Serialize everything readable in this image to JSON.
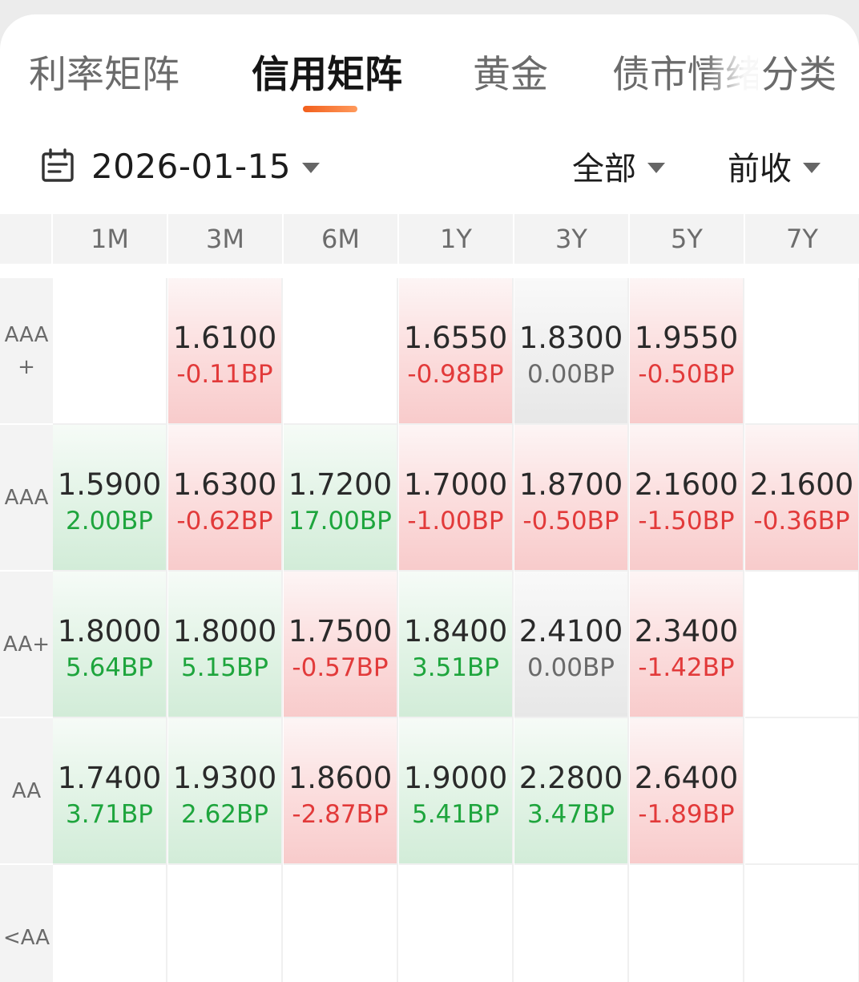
{
  "tabs": [
    {
      "label": "利率矩阵",
      "active": false
    },
    {
      "label": "信用矩阵",
      "active": true
    },
    {
      "label": "黄金",
      "active": false
    },
    {
      "label": "债市情绪",
      "active": false
    },
    {
      "label": "分类",
      "active": false
    }
  ],
  "filters": {
    "date": "2026-01-15",
    "scope": "全部",
    "basis": "前收"
  },
  "colors": {
    "accent": "#f25f1c",
    "up_text": "#e23a3a",
    "down_text": "#1ea53d",
    "flat_text": "#6a6a6a"
  },
  "matrix": {
    "columns": [
      "1M",
      "3M",
      "6M",
      "1Y",
      "3Y",
      "5Y",
      "7Y"
    ],
    "rows": [
      {
        "label": "AAA+",
        "cells": [
          null,
          {
            "rate": "1.6100",
            "change": "-0.11BP",
            "dir": "up"
          },
          null,
          {
            "rate": "1.6550",
            "change": "-0.98BP",
            "dir": "up"
          },
          {
            "rate": "1.8300",
            "change": "0.00BP",
            "dir": "flat"
          },
          {
            "rate": "1.9550",
            "change": "-0.50BP",
            "dir": "up"
          },
          null
        ]
      },
      {
        "label": "AAA",
        "cells": [
          {
            "rate": "1.5900",
            "change": "2.00BP",
            "dir": "down"
          },
          {
            "rate": "1.6300",
            "change": "-0.62BP",
            "dir": "up"
          },
          {
            "rate": "1.7200",
            "change": "17.00BP",
            "dir": "down"
          },
          {
            "rate": "1.7000",
            "change": "-1.00BP",
            "dir": "up"
          },
          {
            "rate": "1.8700",
            "change": "-0.50BP",
            "dir": "up"
          },
          {
            "rate": "2.1600",
            "change": "-1.50BP",
            "dir": "up"
          },
          {
            "rate": "2.1600",
            "change": "-0.36BP",
            "dir": "up"
          }
        ]
      },
      {
        "label": "AA+",
        "cells": [
          {
            "rate": "1.8000",
            "change": "5.64BP",
            "dir": "down"
          },
          {
            "rate": "1.8000",
            "change": "5.15BP",
            "dir": "down"
          },
          {
            "rate": "1.7500",
            "change": "-0.57BP",
            "dir": "up"
          },
          {
            "rate": "1.8400",
            "change": "3.51BP",
            "dir": "down"
          },
          {
            "rate": "2.4100",
            "change": "0.00BP",
            "dir": "flat"
          },
          {
            "rate": "2.3400",
            "change": "-1.42BP",
            "dir": "up"
          },
          null
        ]
      },
      {
        "label": "AA",
        "cells": [
          {
            "rate": "1.7400",
            "change": "3.71BP",
            "dir": "down"
          },
          {
            "rate": "1.9300",
            "change": "2.62BP",
            "dir": "down"
          },
          {
            "rate": "1.8600",
            "change": "-2.87BP",
            "dir": "up"
          },
          {
            "rate": "1.9000",
            "change": "5.41BP",
            "dir": "down"
          },
          {
            "rate": "2.2800",
            "change": "3.47BP",
            "dir": "down"
          },
          {
            "rate": "2.6400",
            "change": "-1.89BP",
            "dir": "up"
          },
          null
        ]
      },
      {
        "label": "<AA",
        "cells": [
          null,
          null,
          null,
          null,
          null,
          null,
          null
        ]
      }
    ]
  }
}
